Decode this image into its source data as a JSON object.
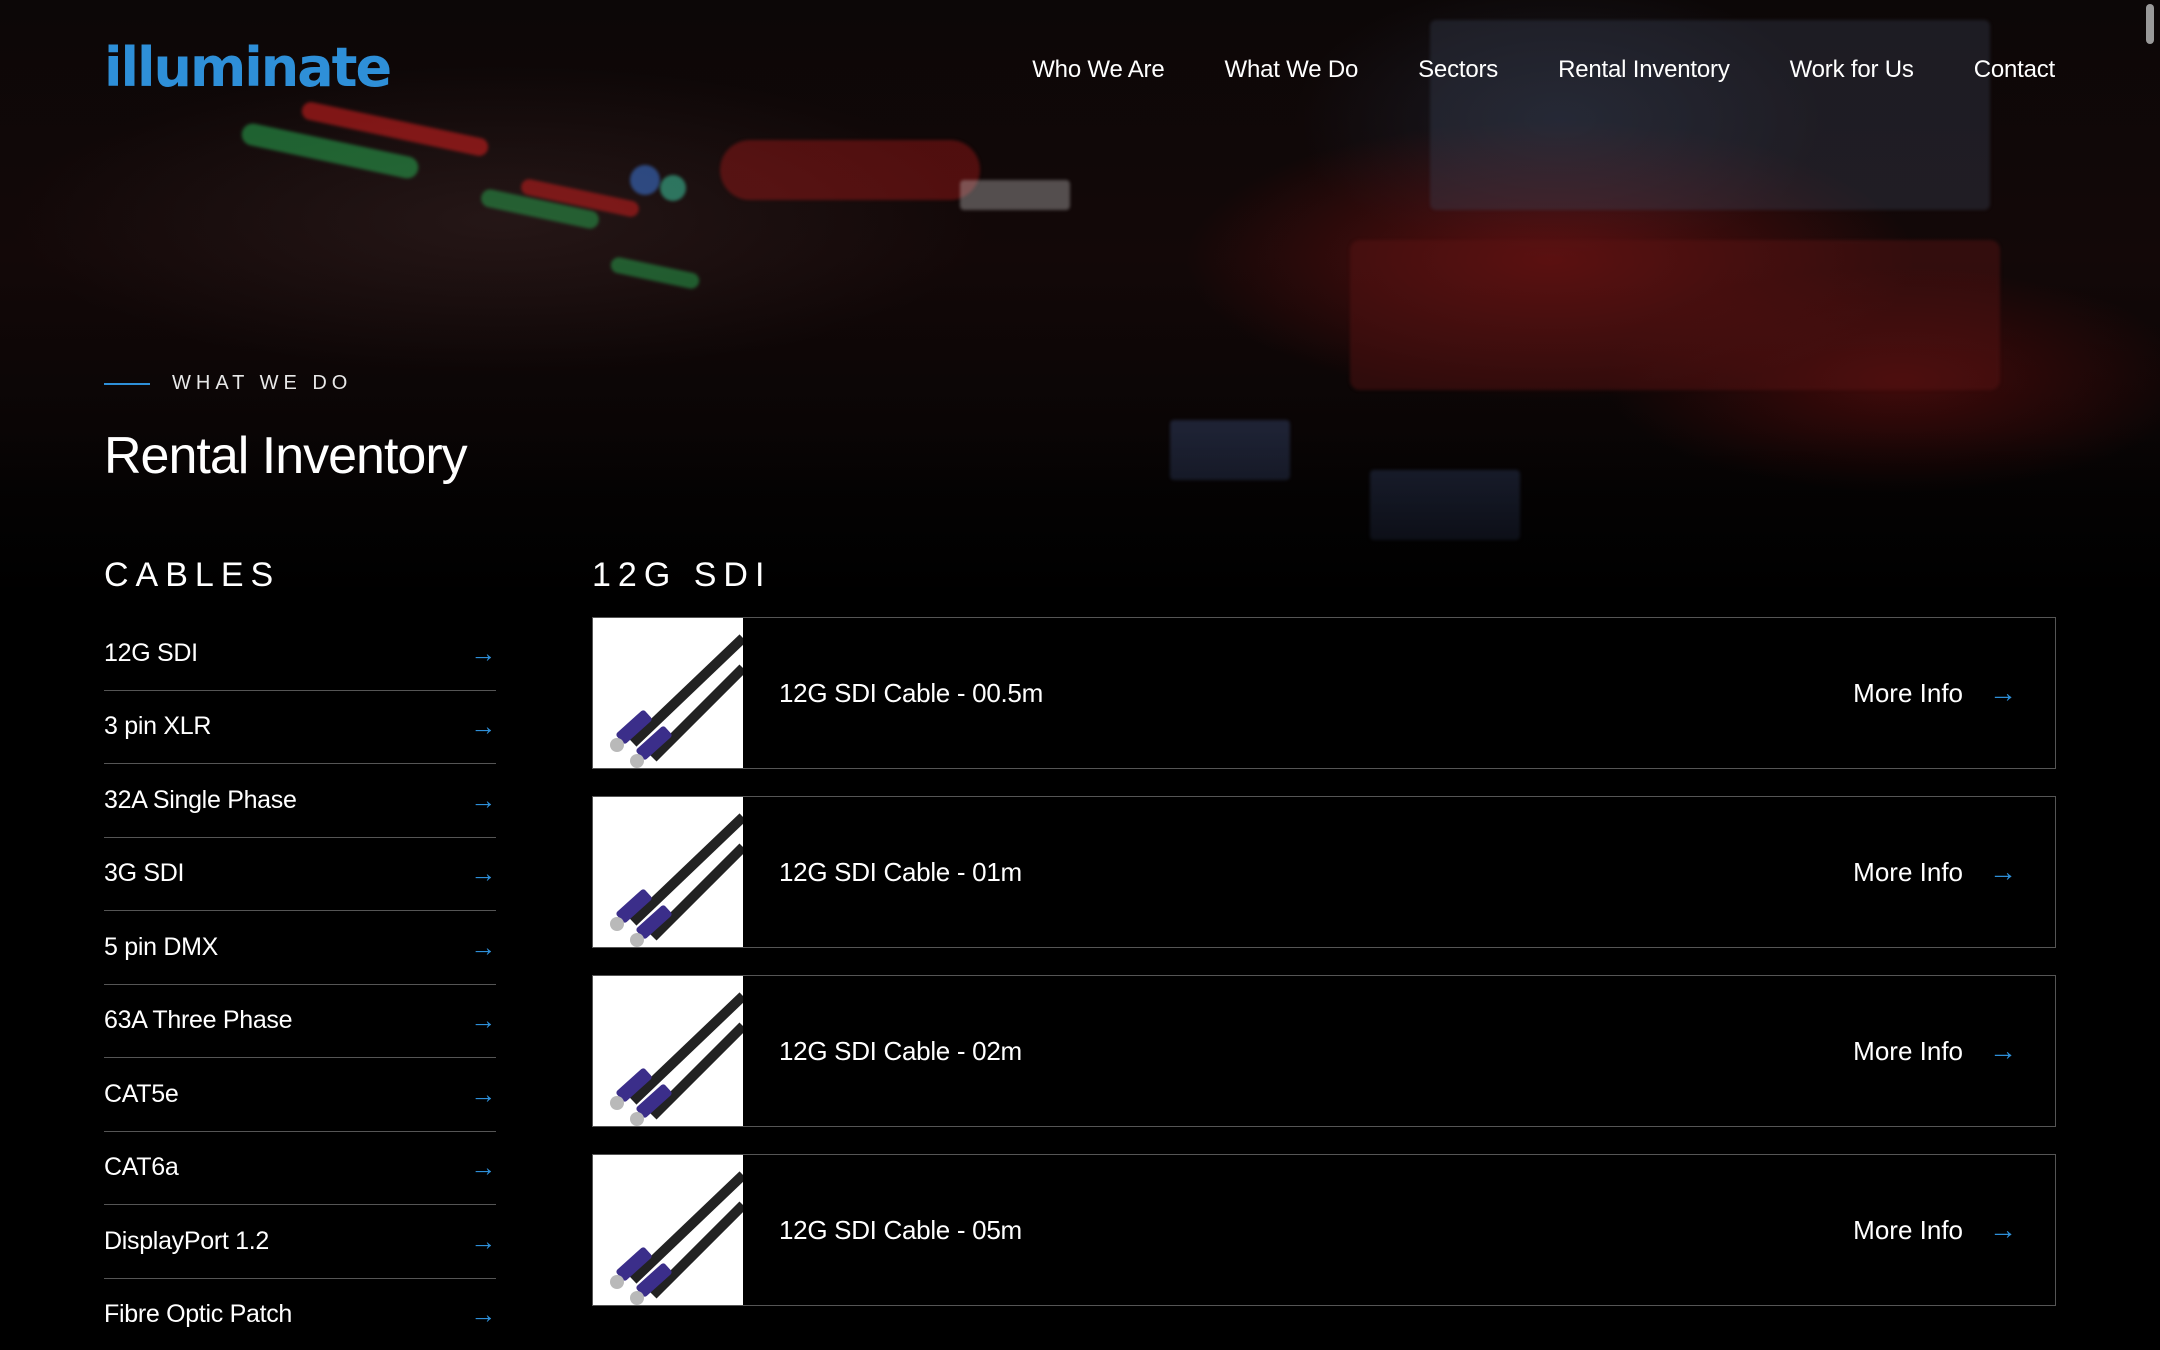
{
  "brand": {
    "logo_text": "illuminate",
    "accent": "#2e8fd8"
  },
  "nav": [
    {
      "label": "Who We Are"
    },
    {
      "label": "What We Do"
    },
    {
      "label": "Sectors"
    },
    {
      "label": "Rental Inventory"
    },
    {
      "label": "Work for Us"
    },
    {
      "label": "Contact"
    }
  ],
  "hero": {
    "eyebrow": "WHAT WE DO",
    "title": "Rental Inventory"
  },
  "sidebar": {
    "heading": "CABLES",
    "items": [
      {
        "label": "12G SDI"
      },
      {
        "label": "3 pin XLR"
      },
      {
        "label": "32A Single Phase"
      },
      {
        "label": "3G SDI"
      },
      {
        "label": "5 pin DMX"
      },
      {
        "label": "63A Three Phase"
      },
      {
        "label": "CAT5e"
      },
      {
        "label": "CAT6a"
      },
      {
        "label": "DisplayPort 1.2"
      },
      {
        "label": "Fibre Optic Patch"
      }
    ]
  },
  "main": {
    "heading": "12G SDI",
    "products": [
      {
        "title": "12G SDI Cable - 00.5m",
        "cta": "More Info"
      },
      {
        "title": "12G SDI Cable - 01m",
        "cta": "More Info"
      },
      {
        "title": "12G SDI Cable - 02m",
        "cta": "More Info"
      },
      {
        "title": "12G SDI Cable - 05m",
        "cta": "More Info"
      }
    ]
  },
  "icons": {
    "arrow": "→"
  }
}
